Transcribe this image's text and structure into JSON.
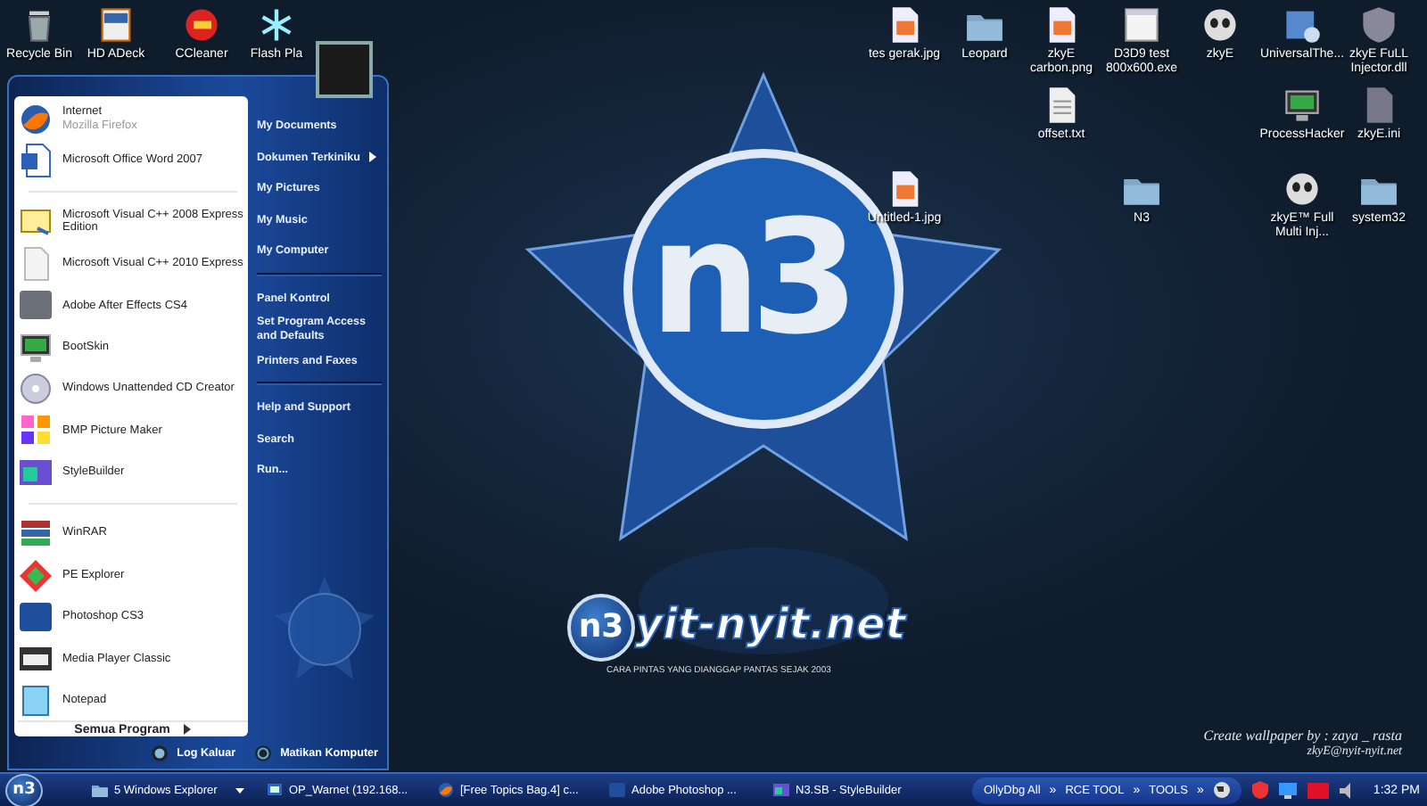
{
  "desktop_icons": [
    {
      "label": "Recycle Bin",
      "kind": "trash"
    },
    {
      "label": "HD ADeck",
      "kind": "deck"
    },
    {
      "label": "CCleaner",
      "kind": "cleaner"
    },
    {
      "label": "Flash Pla",
      "kind": "snow"
    },
    {
      "label": "tes gerak.jpg",
      "kind": "image"
    },
    {
      "label": "Leopard",
      "kind": "folder"
    },
    {
      "label": "zkyE carbon.png",
      "kind": "image"
    },
    {
      "label": "D3D9 test 800x600.exe",
      "kind": "exe"
    },
    {
      "label": "zkyE",
      "kind": "skull"
    },
    {
      "label": "UniversalThe...",
      "kind": "app"
    },
    {
      "label": "zkyE FuLL Injector.dll",
      "kind": "shield"
    },
    {
      "label": "offset.txt",
      "kind": "textfile"
    },
    {
      "label": "ProcessHacker",
      "kind": "monitor"
    },
    {
      "label": "zkyE.ini",
      "kind": "file"
    },
    {
      "label": "Untitled-1.jpg",
      "kind": "image"
    },
    {
      "label": "N3",
      "kind": "folder"
    },
    {
      "label": "zkyE™ Full Multi Inj...",
      "kind": "skull"
    },
    {
      "label": "system32",
      "kind": "folder"
    }
  ],
  "wallpaper": {
    "logo_text": "n3",
    "badge_text": "n3",
    "site": "yit-nyit.net",
    "tagline": "CARA PINTAS YANG DIANGGAP PANTAS SEJAK 2003",
    "credit": [
      "Create wallpaper by : zaya _ rasta",
      "zkyE@nyit-nyit.net"
    ]
  },
  "start_menu": {
    "pinned": [
      {
        "title": "Internet",
        "subtitle": "Mozilla Firefox",
        "kind": "globe"
      },
      {
        "title": "Microsoft Office Word 2007",
        "kind": "word"
      }
    ],
    "recent": [
      {
        "title": "Microsoft Visual C++ 2008 Express Edition",
        "kind": "vc"
      },
      {
        "title": "Microsoft Visual C++ 2010 Express",
        "kind": "blank"
      },
      {
        "title": "Adobe After Effects CS4",
        "kind": "greytile"
      },
      {
        "title": "BootSkin",
        "kind": "monitor"
      },
      {
        "title": "Windows Unattended CD Creator",
        "kind": "disc"
      },
      {
        "title": "BMP Picture Maker",
        "kind": "blocks"
      },
      {
        "title": "StyleBuilder",
        "kind": "window"
      },
      {
        "title": "WinRAR",
        "kind": "books"
      },
      {
        "title": "PE Explorer",
        "kind": "diamond"
      },
      {
        "title": "Photoshop CS3",
        "kind": "bluetile"
      },
      {
        "title": "Media Player Classic",
        "kind": "film"
      },
      {
        "title": "Notepad",
        "kind": "notepad"
      }
    ],
    "all_programs": "Semua Program",
    "places": [
      [
        {
          "label": "My Documents",
          "submenu": false
        },
        {
          "label": "Dokumen Terkiniku",
          "submenu": true
        },
        {
          "label": "My Pictures",
          "submenu": false
        },
        {
          "label": "My Music",
          "submenu": false
        },
        {
          "label": "My Computer",
          "submenu": false
        }
      ],
      [
        {
          "label": "Panel Kontrol",
          "submenu": false
        },
        {
          "label": "Set Program Access and Defaults",
          "submenu": false
        },
        {
          "label": "Printers and Faxes",
          "submenu": false
        }
      ],
      [
        {
          "label": "Help and Support",
          "submenu": false
        },
        {
          "label": "Search",
          "submenu": false
        },
        {
          "label": "Run...",
          "submenu": false
        }
      ]
    ],
    "footer": [
      {
        "label": "Log Kaluar",
        "kind": "logoff"
      },
      {
        "label": "Matikan Komputer",
        "kind": "power"
      }
    ]
  },
  "taskbar": {
    "start_label": "n3",
    "tasks": [
      {
        "label": "5 Windows Explorer",
        "kind": "folder",
        "grouped": true
      },
      {
        "label": "OP_Warnet (192.168...",
        "kind": "remote",
        "grouped": false
      },
      {
        "label": "[Free Topics Bag.4] c...",
        "kind": "globe",
        "grouped": false
      },
      {
        "label": "Adobe Photoshop ...",
        "kind": "bluetile",
        "grouped": false
      },
      {
        "label": "N3.SB - StyleBuilder",
        "kind": "window",
        "grouped": false
      }
    ],
    "toolbars": [
      "OllyDbg All",
      "RCE TOOL",
      "TOOLS"
    ],
    "chevron": "»",
    "clock": "1:32 PM"
  }
}
